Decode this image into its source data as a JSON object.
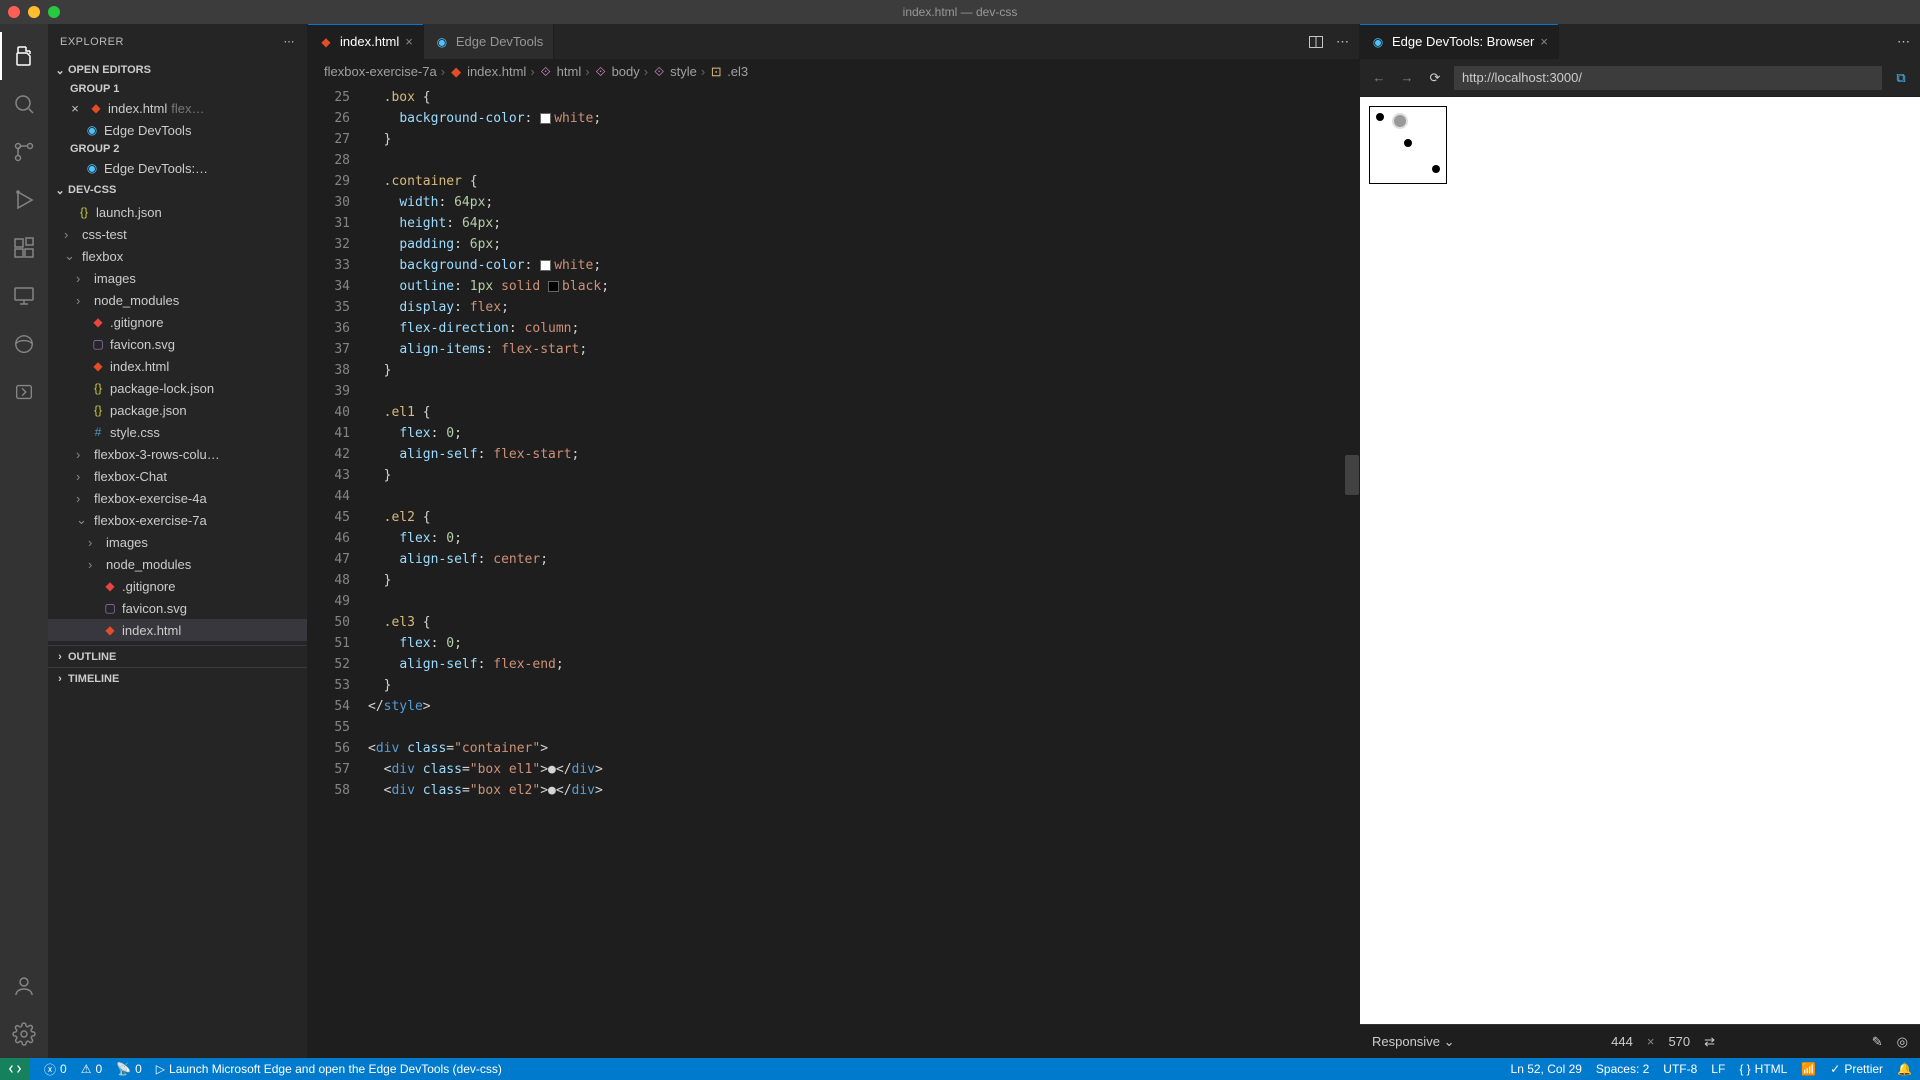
{
  "window": {
    "title": "index.html — dev-css"
  },
  "sidebar": {
    "header": "EXPLORER",
    "openEditors": "OPEN EDITORS",
    "group1": "GROUP 1",
    "group2": "GROUP 2",
    "item_index": "index.html",
    "item_index_suffix": "flex…",
    "item_edge": "Edge DevTools",
    "item_edge_browser": "Edge DevTools:…",
    "project": "DEV-CSS",
    "files": {
      "launch": "launch.json",
      "csstest": "css-test",
      "flexbox": "flexbox",
      "images": "images",
      "node_modules": "node_modules",
      "gitignore": ".gitignore",
      "favicon": "favicon.svg",
      "index": "index.html",
      "pkglock": "package-lock.json",
      "pkg": "package.json",
      "style": "style.css",
      "flex3": "flexbox-3-rows-colu…",
      "flexchat": "flexbox-Chat",
      "flex4a": "flexbox-exercise-4a",
      "flex7a": "flexbox-exercise-7a",
      "images2": "images",
      "node2": "node_modules",
      "gitignore2": ".gitignore",
      "favicon2": "favicon.svg",
      "index2": "index.html"
    },
    "outline": "OUTLINE",
    "timeline": "TIMELINE"
  },
  "tabs": {
    "index": "index.html",
    "edge": "Edge DevTools",
    "edgeBrowser": "Edge DevTools: Browser"
  },
  "breadcrumb": {
    "p1": "flexbox-exercise-7a",
    "p2": "index.html",
    "p3": "html",
    "p4": "body",
    "p5": "style",
    "p6": ".el3"
  },
  "browser": {
    "url": "http://localhost:3000/",
    "responsive": "Responsive",
    "width": "444",
    "height": "570"
  },
  "status": {
    "err": "0",
    "warn": "0",
    "port": "0",
    "launch": "Launch Microsoft Edge and open the Edge DevTools (dev-css)",
    "lncol": "Ln 52, Col 29",
    "spaces": "Spaces: 2",
    "enc": "UTF-8",
    "eol": "LF",
    "lang": "HTML",
    "prettier": "Prettier"
  },
  "code": {
    "lines": [
      25,
      26,
      27,
      28,
      29,
      30,
      31,
      32,
      33,
      34,
      35,
      36,
      37,
      38,
      39,
      40,
      41,
      42,
      43,
      44,
      45,
      46,
      47,
      48,
      49,
      50,
      51,
      52,
      53,
      54,
      55,
      56,
      57,
      58
    ],
    "boxSel": ".box",
    "bgProp": "background-color",
    "containerSel": ".container",
    "width": "width",
    "w64": "64px",
    "height": "height",
    "h64": "64px",
    "padding": "padding",
    "p6": "6px",
    "outline": "outline",
    "o1": "1px",
    "solid": "solid",
    "black": "black",
    "display": "display",
    "flex": "flex",
    "flexdir": "flex-direction",
    "column": "column",
    "alignitems": "align-items",
    "flexstart": "flex-start",
    "flexprop": "flex",
    "zero": "0",
    "alignself": "align-self",
    "center": "center",
    "flexend": "flex-end",
    "white": "white",
    "divOpen": "div",
    "classAttr": "class",
    "container": "container",
    "box_el1": "box el1",
    "box_el2": "box el2",
    "closeStyle": "style"
  }
}
